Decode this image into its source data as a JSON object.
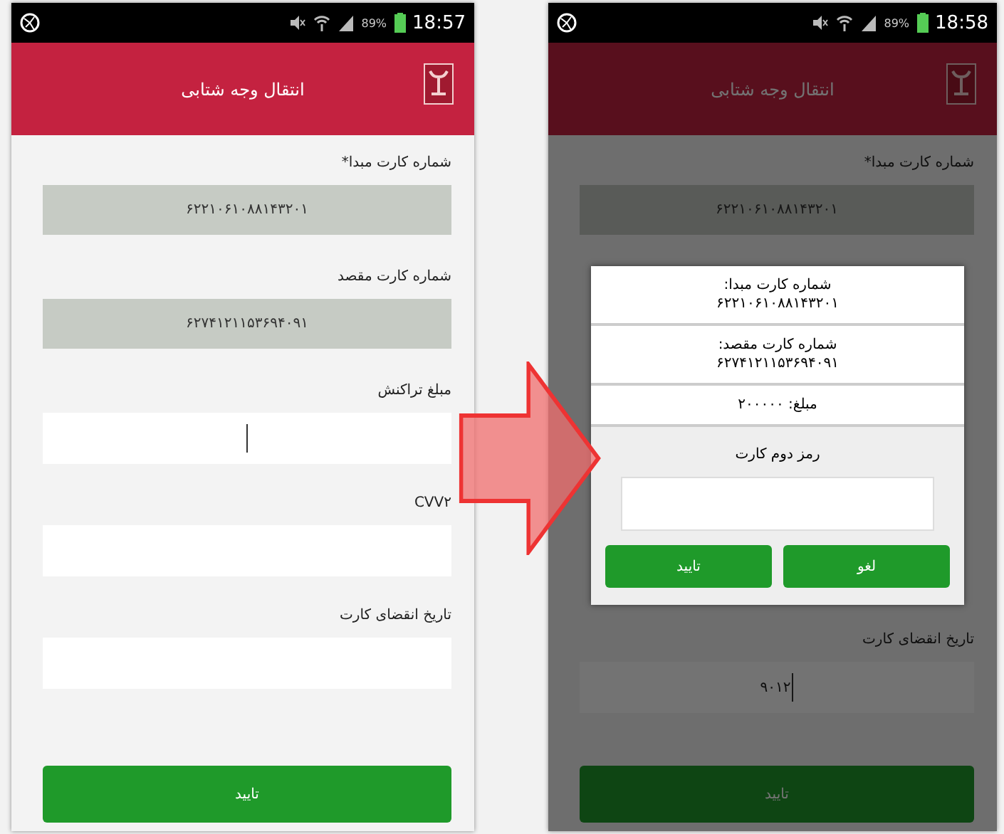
{
  "left_screen": {
    "status_bar": {
      "battery_percent": "89%",
      "time": "18:57"
    },
    "title": "انتقال وجه شتابی",
    "dimmed": false,
    "form": {
      "fields": [
        {
          "kind": "readonly",
          "label": "شماره کارت مبدا*",
          "value": "۶۲۲۱۰۶۱۰۸۸۱۴۳۲۰۱",
          "focused": false
        },
        {
          "kind": "readonly",
          "label": "شماره کارت مقصد",
          "value": "۶۲۷۴۱۲۱۱۵۳۶۹۴۰۹۱",
          "focused": false
        },
        {
          "kind": "input",
          "label": "مبلغ تراکنش",
          "focused": true
        },
        {
          "kind": "input",
          "label": "CVV۲",
          "focused": false
        },
        {
          "kind": "input",
          "label": "تاریخ انقضای کارت",
          "focused": false
        }
      ],
      "button": "تایید"
    }
  },
  "right_screen": {
    "status_bar": {
      "battery_percent": "89%",
      "time": "18:58"
    },
    "title": "انتقال وجه شتابی",
    "dimmed": true,
    "form": {
      "fields": [
        {
          "kind": "readonly",
          "label": "شماره کارت مبدا*",
          "value": "۶۲۲۱۰۶۱۰۸۸۱۴۳۲۰۱",
          "focused": false
        },
        {
          "kind": "input",
          "label": "تاریخ انقضای کارت",
          "value": "۹۰۱۲",
          "focused": true
        }
      ],
      "button": "تایید"
    },
    "dialog": {
      "rows": [
        {
          "label": "شماره کارت مبدا:",
          "value": "۶۲۲۱۰۶۱۰۸۸۱۴۳۲۰۱"
        },
        {
          "label": "شماره کارت مقصد:",
          "value": "۶۲۷۴۱۲۱۱۵۳۶۹۴۰۹۱"
        },
        {
          "label": "مبلغ: ۲۰۰۰۰۰"
        }
      ],
      "password_label": "رمز دوم کارت",
      "buttons": [
        "لغو",
        "تایید"
      ]
    }
  }
}
